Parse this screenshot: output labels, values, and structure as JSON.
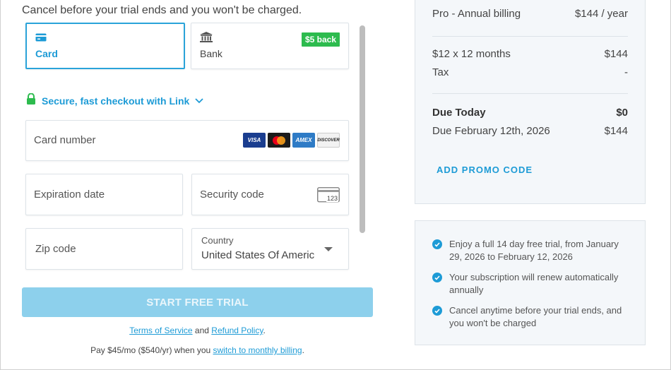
{
  "header": {
    "subtitle": "Cancel before your trial ends and you won't be charged."
  },
  "payment_methods": [
    {
      "label": "Card",
      "icon": "credit-card-icon",
      "selected": true
    },
    {
      "label": "Bank",
      "icon": "bank-icon",
      "selected": false,
      "badge": "$5 back"
    }
  ],
  "link_checkout": {
    "label": "Secure, fast checkout with Link",
    "icon": "lock-icon"
  },
  "form": {
    "card_number_placeholder": "Card number",
    "card_brands": [
      "VISA",
      "MC",
      "AMEX",
      "DISCOVER"
    ],
    "expiration_placeholder": "Expiration date",
    "security_placeholder": "Security code",
    "security_icon_text": "123",
    "zip_placeholder": "Zip code",
    "country_label": "Country",
    "country_value": "United States Of Americ"
  },
  "cta": {
    "label": "START FREE TRIAL"
  },
  "legal": {
    "terms": "Terms of Service",
    "and": "and",
    "refund": "Refund Policy",
    "period": ".",
    "pay_prefix": "Pay $45/mo ($540/yr) when you",
    "switch_link": "switch to monthly billing",
    "pay_suffix": "."
  },
  "summary": {
    "plan_label": "Pro - Annual billing",
    "plan_price": "$144 / year",
    "items": [
      {
        "label": "$12 x 12 months",
        "value": "$144"
      },
      {
        "label": "Tax",
        "value": "-"
      }
    ],
    "due_today_label": "Due Today",
    "due_today_value": "$0",
    "due_later_label": "Due February 12th, 2026",
    "due_later_value": "$144",
    "promo_label": "ADD PROMO CODE"
  },
  "benefits": [
    "Enjoy a full 14 day free trial, from January 29, 2026 to February 12, 2026",
    "Your subscription will renew automatically annually",
    "Cancel anytime before your trial ends, and you won't be charged"
  ],
  "colors": {
    "accent": "#1d9bd6",
    "cta_disabled": "#8dd0ec",
    "badge_green": "#2dbb4e",
    "panel_bg": "#f4f7fa"
  }
}
